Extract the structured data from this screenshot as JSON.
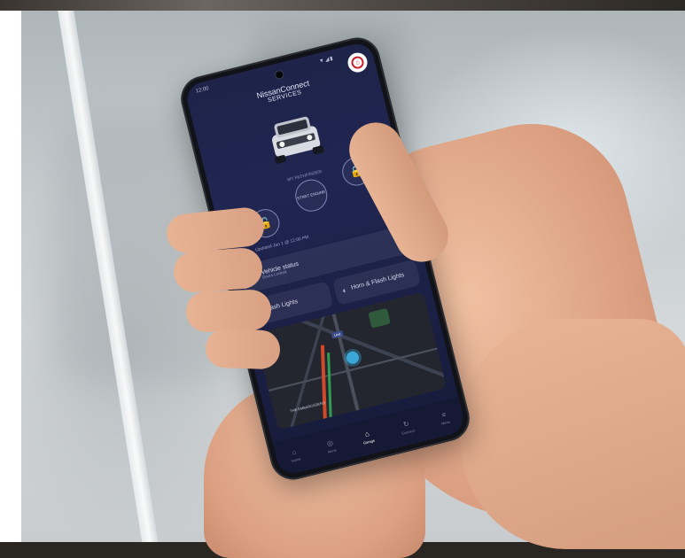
{
  "app": {
    "brand_line1": "NissanConnect",
    "brand_line2": "SERVICES"
  },
  "status_bar": {
    "time": "12:00",
    "icons": "▼◢▮"
  },
  "vehicle": {
    "name": "MY PATHFINDER",
    "updated": "Updated Jan 1 @ 12:00 PM"
  },
  "controls": {
    "lock_left_icon": "🔓",
    "start_label": "START ENGINE",
    "lock_right_icon": "🔒"
  },
  "tiles": {
    "vehicle_status": "Vehicle status",
    "vehicle_status_sub": "Doors Locked",
    "flash_lights": "Flash Lights",
    "horn_and_lights": "Horn & Flash Lights"
  },
  "map": {
    "street": "THE EMBARCADERO",
    "location_label": "Unit"
  },
  "tabbar": {
    "items": [
      {
        "label": "Home",
        "icon": "⌂"
      },
      {
        "label": "Alerts",
        "icon": "◎"
      },
      {
        "label": "Garage",
        "icon": "⌂"
      },
      {
        "label": "Connect",
        "icon": "↻"
      },
      {
        "label": "Menu",
        "icon": "≡"
      }
    ]
  },
  "colors": {
    "screen_bg": "#1e2348",
    "accent": "#c8202b",
    "map_pin": "#3aa7d8"
  }
}
